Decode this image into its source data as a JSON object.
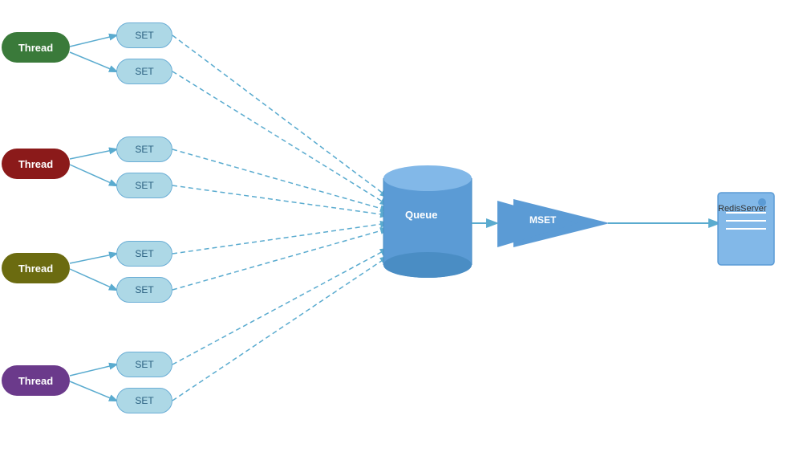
{
  "threads": [
    {
      "id": "thread-green",
      "label": "Thread",
      "color": "#3a7a3a"
    },
    {
      "id": "thread-red",
      "label": "Thread",
      "color": "#8b1a1a"
    },
    {
      "id": "thread-olive",
      "label": "Thread",
      "color": "#6b6b10"
    },
    {
      "id": "thread-purple",
      "label": "Thread",
      "color": "#6b3a8b"
    }
  ],
  "sets": {
    "label": "SET"
  },
  "queue": {
    "label": "Queue"
  },
  "mset": {
    "label": "MSET"
  },
  "redis": {
    "label": "RedisServer"
  }
}
